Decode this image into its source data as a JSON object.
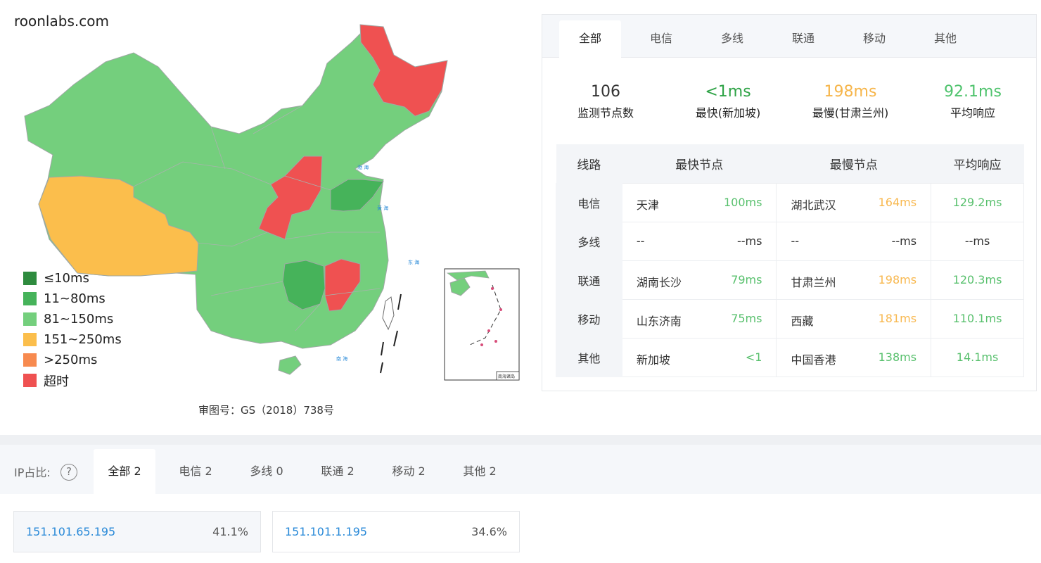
{
  "site": {
    "name": "roonlabs.com"
  },
  "legend": [
    {
      "label": "≤10ms",
      "color": "#2e8b3e"
    },
    {
      "label": "11~80ms",
      "color": "#46b35a"
    },
    {
      "label": "81~150ms",
      "color": "#74cf7d"
    },
    {
      "label": "151~250ms",
      "color": "#fbbe4c"
    },
    {
      "label": ">250ms",
      "color": "#f78a4f"
    },
    {
      "label": "超时",
      "color": "#ef5151"
    }
  ],
  "map": {
    "caption": "审图号：GS（2018）738号",
    "inset_label": "南海诸岛"
  },
  "tabs": [
    "全部",
    "电信",
    "多线",
    "联通",
    "移动",
    "其他"
  ],
  "active_tab": "全部",
  "summary": {
    "nodes": {
      "value": "106",
      "label": "监测节点数"
    },
    "fastest": {
      "value": "<1ms",
      "label": "最快(新加坡)"
    },
    "slowest": {
      "value": "198ms",
      "label": "最慢(甘肃兰州)"
    },
    "average": {
      "value": "92.1ms",
      "label": "平均响应"
    }
  },
  "table": {
    "headers": [
      "线路",
      "最快节点",
      "最慢节点",
      "平均响应"
    ],
    "rows": [
      {
        "line": "电信",
        "fast_node": "天津",
        "fast_ms": "100ms",
        "slow_node": "湖北武汉",
        "slow_ms": "164ms",
        "avg": "129.2ms"
      },
      {
        "line": "多线",
        "fast_node": "--",
        "fast_ms": "--ms",
        "slow_node": "--",
        "slow_ms": "--ms",
        "avg": "--ms"
      },
      {
        "line": "联通",
        "fast_node": "湖南长沙",
        "fast_ms": "79ms",
        "slow_node": "甘肃兰州",
        "slow_ms": "198ms",
        "avg": "120.3ms"
      },
      {
        "line": "移动",
        "fast_node": "山东济南",
        "fast_ms": "75ms",
        "slow_node": "西藏",
        "slow_ms": "181ms",
        "avg": "110.1ms"
      },
      {
        "line": "其他",
        "fast_node": "新加坡",
        "fast_ms": "<1",
        "slow_node": "中国香港",
        "slow_ms": "138ms",
        "avg": "14.1ms"
      }
    ]
  },
  "ip": {
    "label": "IP占比:",
    "help": "?",
    "tabs": [
      "全部 2",
      "电信 2",
      "多线 0",
      "联通 2",
      "移动 2",
      "其他 2"
    ],
    "active_tab": "全部 2",
    "items": [
      {
        "address": "151.101.65.195",
        "percent": "41.1%"
      },
      {
        "address": "151.101.1.195",
        "percent": "34.6%"
      }
    ]
  }
}
